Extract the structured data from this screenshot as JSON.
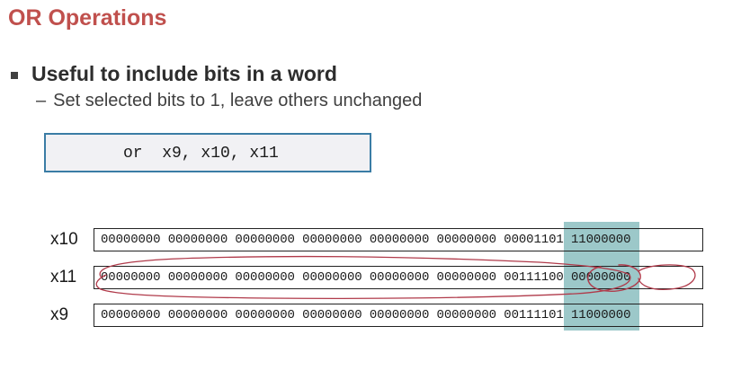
{
  "slide": {
    "title": "OR Operations",
    "bullet": "Useful to include bits in a word",
    "sub_dash": "–",
    "sub_bullet": "Set selected bits to 1, leave others unchanged",
    "code": "or  x9, x10, x11"
  },
  "registers": [
    {
      "label": "x10",
      "value": "00000000 00000000 00000000 00000000 00000000 00000000 00001101 11000000"
    },
    {
      "label": "x11",
      "value": "00000000 00000000 00000000 00000000 00000000 00000000 00111100 00000000"
    },
    {
      "label": "x9",
      "value": "00000000 00000000 00000000 00000000 00000000 00000000 00111101 11000000"
    }
  ],
  "colors": {
    "title": "#c0504d",
    "highlight": "#9cc8c9",
    "code_border": "#3a7ca5",
    "annotation": "#b03a4a"
  }
}
